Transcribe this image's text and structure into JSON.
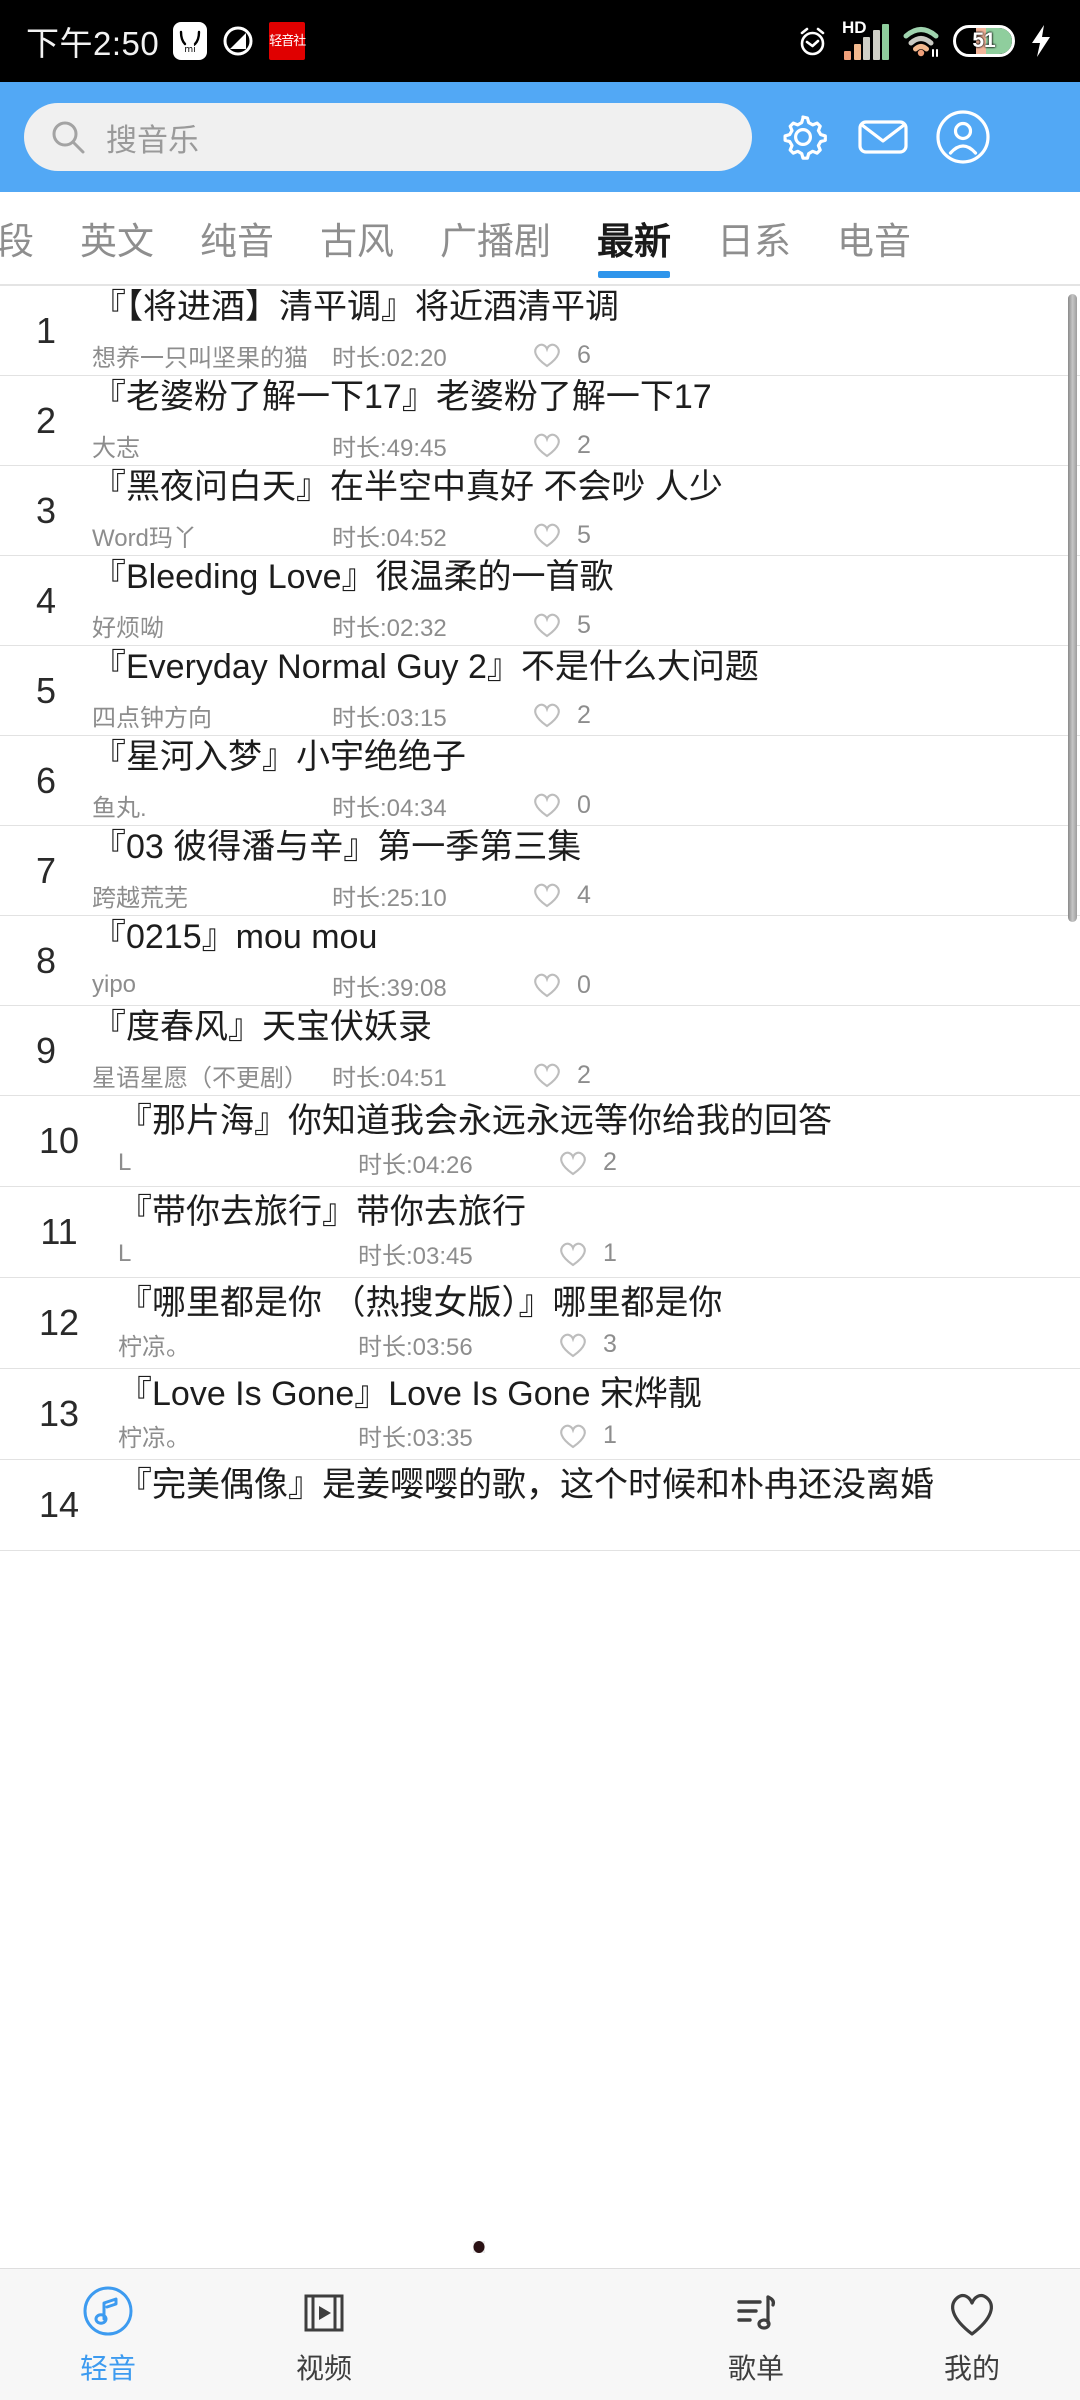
{
  "status_bar": {
    "time": "下午2:50",
    "app_badge_text": "轻音社",
    "battery_level": "51",
    "network_label": "HD",
    "icons": [
      "mi-icon",
      "circle-slash-icon",
      "app-badge-icon",
      "alarm-icon",
      "signal-icon",
      "wifi-icon",
      "battery-icon",
      "charging-bolt-icon"
    ]
  },
  "header": {
    "search_placeholder": "搜音乐",
    "search_value": "",
    "accent_color": "#52a8f5",
    "icons": [
      "search-icon",
      "gear-icon",
      "mail-icon",
      "account-icon"
    ]
  },
  "tabs": {
    "items": [
      {
        "label": "段",
        "active": false
      },
      {
        "label": "英文",
        "active": false
      },
      {
        "label": "纯音",
        "active": false
      },
      {
        "label": "古风",
        "active": false
      },
      {
        "label": "广播剧",
        "active": false
      },
      {
        "label": "最新",
        "active": true
      },
      {
        "label": "日系",
        "active": false
      },
      {
        "label": "电音",
        "active": false
      }
    ],
    "indicator_color": "#2f95eb"
  },
  "list": {
    "duration_prefix": "时长:",
    "items": [
      {
        "num": "1",
        "title": "『【将进酒】清平调』将近酒清平调",
        "artist": "想养一只叫坚果的猫",
        "duration": "时长:02:20",
        "likes": "6"
      },
      {
        "num": "2",
        "title": "『老婆粉了解一下17』老婆粉了解一下17",
        "artist": "大志",
        "duration": "时长:49:45",
        "likes": "2"
      },
      {
        "num": "3",
        "title": "『黑夜问白天』在半空中真好 不会吵 人少",
        "artist": "Word玛丫",
        "duration": "时长:04:52",
        "likes": "5"
      },
      {
        "num": "4",
        "title": "『Bleeding Love』很温柔的一首歌",
        "artist": "好烦呦",
        "duration": "时长:02:32",
        "likes": "5"
      },
      {
        "num": "5",
        "title": "『Everyday Normal Guy 2』不是什么大问题",
        "artist": "四点钟方向",
        "duration": "时长:03:15",
        "likes": "2"
      },
      {
        "num": "6",
        "title": "『星河入梦』小宇绝绝子",
        "artist": "鱼丸.",
        "duration": "时长:04:34",
        "likes": "0"
      },
      {
        "num": "7",
        "title": "『03 彼得潘与辛』第一季第三集",
        "artist": "跨越荒芜",
        "duration": "时长:25:10",
        "likes": "4"
      },
      {
        "num": "8",
        "title": "『0215』mou mou",
        "artist": "yipo",
        "duration": "时长:39:08",
        "likes": "0"
      },
      {
        "num": "9",
        "title": "『度春风』天宝伏妖录",
        "artist": "星语星愿（不更剧）",
        "duration": "时长:04:51",
        "likes": "2"
      },
      {
        "num": "10",
        "title": "『那片海』你知道我会永远永远等你给我的回答",
        "artist": "L",
        "duration": "时长:04:26",
        "likes": "2"
      },
      {
        "num": "11",
        "title": "『带你去旅行』带你去旅行",
        "artist": "L",
        "duration": "时长:03:45",
        "likes": "1"
      },
      {
        "num": "12",
        "title": "『哪里都是你 （热搜女版）』哪里都是你",
        "artist": "柠凉。",
        "duration": "时长:03:56",
        "likes": "3"
      },
      {
        "num": "13",
        "title": "『Love Is Gone』Love Is Gone 宋烨靓",
        "artist": "柠凉。",
        "duration": "时长:03:35",
        "likes": "1"
      },
      {
        "num": "14",
        "title": "『完美偶像』是姜嘤嘤的歌，这个时候和朴冉还没离婚",
        "artist": "",
        "duration": "",
        "likes": ""
      }
    ]
  },
  "bottom_nav": {
    "items": [
      {
        "label": "轻音",
        "icon": "music-note-circle-icon",
        "active": true
      },
      {
        "label": "视频",
        "icon": "film-play-icon",
        "active": false
      },
      {
        "label": "",
        "icon": "vinyl-record-icon",
        "active": false
      },
      {
        "label": "歌单",
        "icon": "playlist-note-icon",
        "active": false
      },
      {
        "label": "我的",
        "icon": "heart-icon",
        "active": false
      }
    ],
    "active_color": "#3d9bf0"
  }
}
